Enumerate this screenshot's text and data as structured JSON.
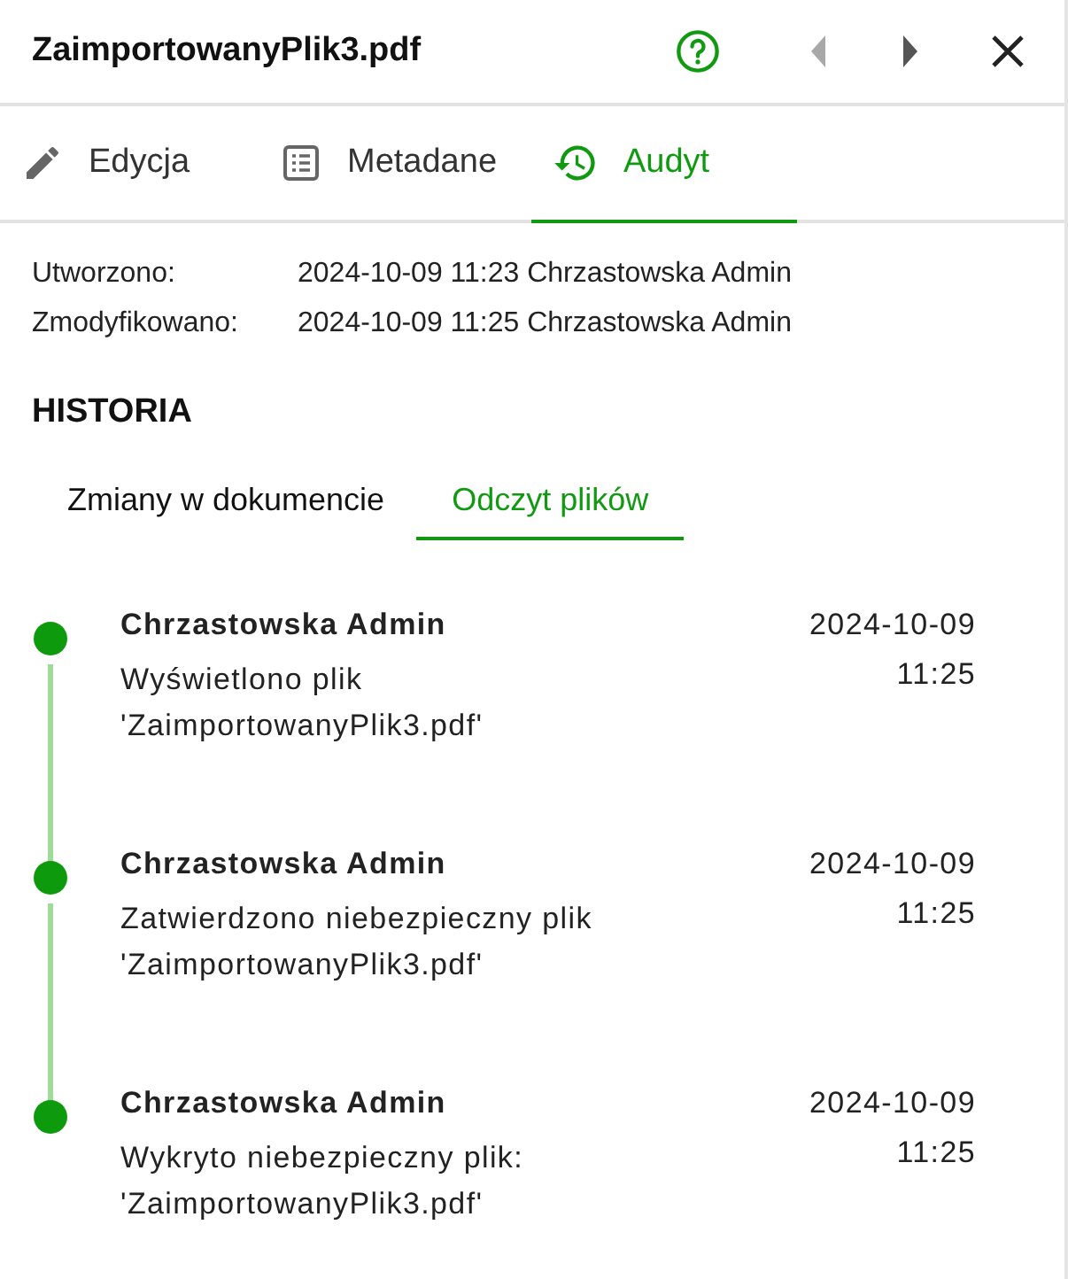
{
  "header": {
    "title": "ZaimportowanyPlik3.pdf",
    "prev_disabled": true,
    "next_disabled": false
  },
  "tabs": [
    {
      "label": "Edycja",
      "kind": "edit",
      "selected": false
    },
    {
      "label": "Metadane",
      "kind": "metadata",
      "selected": false
    },
    {
      "label": "Audyt",
      "kind": "audit",
      "selected": true
    }
  ],
  "info": [
    {
      "label": "Utworzono:",
      "value": "2024-10-09 11:23 Chrzastowska Admin"
    },
    {
      "label": "Zmodyfikowano:",
      "value": "2024-10-09 11:25 Chrzastowska Admin"
    }
  ],
  "history": {
    "title": "HISTORIA",
    "tabs": [
      {
        "label": "Zmiany w dokumencie",
        "selected": false
      },
      {
        "label": "Odczyt plików",
        "selected": true
      }
    ],
    "events": [
      {
        "user": "Chrzastowska Admin",
        "message": "Wyświetlono plik 'ZaimportowanyPlik3.pdf'",
        "date": "2024-10-09",
        "time": "11:25"
      },
      {
        "user": "Chrzastowska Admin",
        "message": "Zatwierdzono niebezpieczny plik 'ZaimportowanyPlik3.pdf'",
        "date": "2024-10-09",
        "time": "11:25"
      },
      {
        "user": "Chrzastowska Admin",
        "message": "Wykryto niebezpieczny plik: 'ZaimportowanyPlik3.pdf'",
        "date": "2024-10-09",
        "time": "11:25"
      }
    ]
  }
}
